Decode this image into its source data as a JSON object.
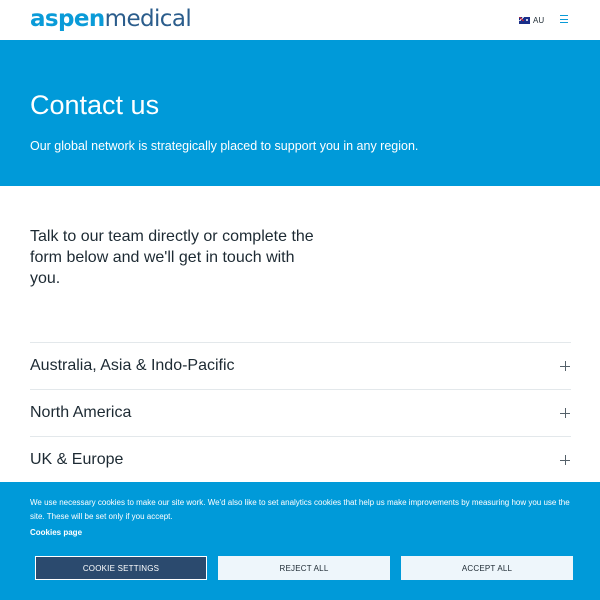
{
  "header": {
    "logo_part1": "aspen",
    "logo_part2": "medical",
    "region_label": "AU",
    "icons": {
      "flag": "australia-flag-icon",
      "menu": "hamburger-menu-icon"
    }
  },
  "hero": {
    "title": "Contact us",
    "subtitle": "Our global network is strategically placed to support you in any region."
  },
  "intro": {
    "text": "Talk to our team directly or complete the form below and we'll get in touch with you."
  },
  "accordion": {
    "items": [
      {
        "label": "Australia, Asia & Indo-Pacific"
      },
      {
        "label": "North America"
      },
      {
        "label": "UK & Europe"
      }
    ],
    "expand_icon": "plus-icon"
  },
  "cookie_banner": {
    "message": "We use necessary cookies to make our site work. We'd also like to set analytics cookies that help us make improvements by measuring how you use the site. These will be set only if you accept.",
    "link": "Cookies page",
    "buttons": {
      "settings": "COOKIE SETTINGS",
      "reject": "REJECT ALL",
      "accept": "ACCEPT ALL"
    }
  },
  "colors": {
    "brand_blue": "#009ad9",
    "brand_dark_blue": "#2b5d8c",
    "settings_button": "#2b4a6e",
    "text": "#1d2a33"
  }
}
